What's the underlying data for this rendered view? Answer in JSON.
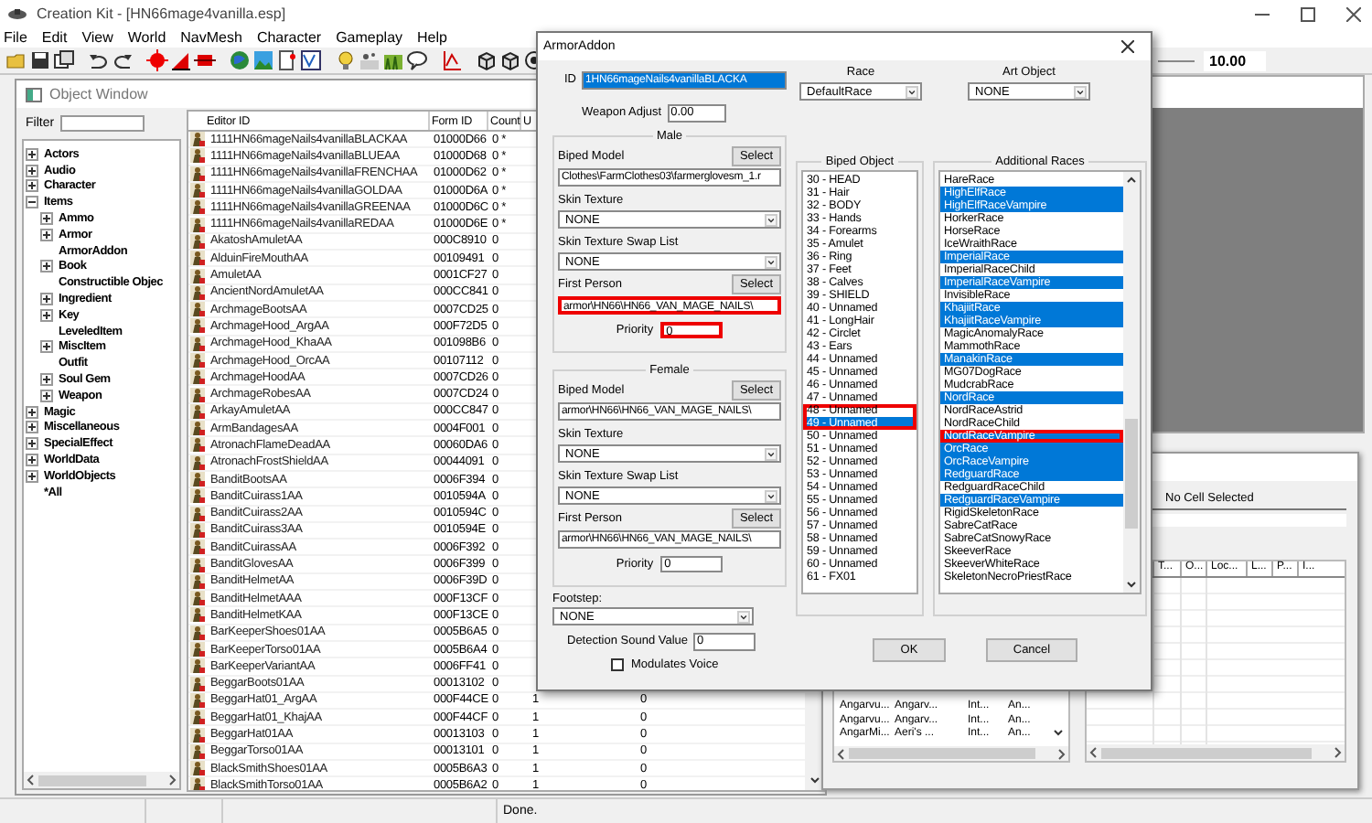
{
  "app_window": {
    "title": "Creation Kit - [HN66mage4vanilla.esp]"
  },
  "menu_bar": [
    "File",
    "Edit",
    "View",
    "World",
    "NavMesh",
    "Character",
    "Gameplay",
    "Help"
  ],
  "toolbar": {
    "zoom_value": "10.00"
  },
  "object_window": {
    "title": "Object Window",
    "filter_label": "Filter",
    "tree": [
      {
        "label": "Actors",
        "kind": "group",
        "expanded": false
      },
      {
        "label": "Audio",
        "kind": "group",
        "expanded": false
      },
      {
        "label": "Character",
        "kind": "group",
        "expanded": false
      },
      {
        "label": "Items",
        "kind": "group",
        "expanded": true,
        "children": [
          {
            "label": "Ammo",
            "kind": "group",
            "expanded": false
          },
          {
            "label": "Armor",
            "kind": "group",
            "expanded": false
          },
          {
            "label": "ArmorAddon",
            "kind": "leaf"
          },
          {
            "label": "Book",
            "kind": "group",
            "expanded": false
          },
          {
            "label": "Constructible Objec",
            "kind": "leaf"
          },
          {
            "label": "Ingredient",
            "kind": "group",
            "expanded": false
          },
          {
            "label": "Key",
            "kind": "group",
            "expanded": false
          },
          {
            "label": "LeveledItem",
            "kind": "leaf"
          },
          {
            "label": "MiscItem",
            "kind": "group",
            "expanded": false
          },
          {
            "label": "Outfit",
            "kind": "leaf"
          },
          {
            "label": "Soul Gem",
            "kind": "group",
            "expanded": false
          },
          {
            "label": "Weapon",
            "kind": "group",
            "expanded": false
          }
        ]
      },
      {
        "label": "Magic",
        "kind": "group",
        "expanded": false
      },
      {
        "label": "Miscellaneous",
        "kind": "group",
        "expanded": false
      },
      {
        "label": "SpecialEffect",
        "kind": "group",
        "expanded": false
      },
      {
        "label": "WorldData",
        "kind": "group",
        "expanded": false
      },
      {
        "label": "WorldObjects",
        "kind": "group",
        "expanded": false
      },
      {
        "label": "*All",
        "kind": "leaf"
      }
    ],
    "table": {
      "columns": [
        "Editor ID",
        "Form ID",
        "Count",
        "U"
      ],
      "rows": [
        {
          "editor_id": "1111HN66mageNails4vanillaBLACKAA",
          "form_id": "01000D66",
          "count": "0 *"
        },
        {
          "editor_id": "1111HN66mageNails4vanillaBLUEAA",
          "form_id": "01000D68",
          "count": "0 *"
        },
        {
          "editor_id": "1111HN66mageNails4vanillaFRENCHAA",
          "form_id": "01000D62",
          "count": "0 *"
        },
        {
          "editor_id": "1111HN66mageNails4vanillaGOLDAA",
          "form_id": "01000D6A",
          "count": "0 *"
        },
        {
          "editor_id": "1111HN66mageNails4vanillaGREENAA",
          "form_id": "01000D6C",
          "count": "0 *"
        },
        {
          "editor_id": "1111HN66mageNails4vanillaREDAA",
          "form_id": "01000D6E",
          "count": "0 *"
        },
        {
          "editor_id": "AkatoshAmuletAA",
          "form_id": "000C8910",
          "count": "0"
        },
        {
          "editor_id": "AlduinFireMouthAA",
          "form_id": "00109491",
          "count": "0"
        },
        {
          "editor_id": "AmuletAA",
          "form_id": "0001CF27",
          "count": "0"
        },
        {
          "editor_id": "AncientNordAmuletAA",
          "form_id": "000CC841",
          "count": "0"
        },
        {
          "editor_id": "ArchmageBootsAA",
          "form_id": "0007CD25",
          "count": "0"
        },
        {
          "editor_id": "ArchmageHood_ArgAA",
          "form_id": "000F72D5",
          "count": "0"
        },
        {
          "editor_id": "ArchmageHood_KhaAA",
          "form_id": "001098B6",
          "count": "0"
        },
        {
          "editor_id": "ArchmageHood_OrcAA",
          "form_id": "00107112",
          "count": "0"
        },
        {
          "editor_id": "ArchmageHoodAA",
          "form_id": "0007CD26",
          "count": "0"
        },
        {
          "editor_id": "ArchmageRobesAA",
          "form_id": "0007CD24",
          "count": "0"
        },
        {
          "editor_id": "ArkayAmuletAA",
          "form_id": "000CC847",
          "count": "0"
        },
        {
          "editor_id": "ArmBandagesAA",
          "form_id": "0004F001",
          "count": "0"
        },
        {
          "editor_id": "AtronachFlameDeadAA",
          "form_id": "00060DA6",
          "count": "0"
        },
        {
          "editor_id": "AtronachFrostShieldAA",
          "form_id": "00044091",
          "count": "0"
        },
        {
          "editor_id": "BanditBootsAA",
          "form_id": "0006F394",
          "count": "0"
        },
        {
          "editor_id": "BanditCuirass1AA",
          "form_id": "0010594A",
          "count": "0"
        },
        {
          "editor_id": "BanditCuirass2AA",
          "form_id": "0010594C",
          "count": "0"
        },
        {
          "editor_id": "BanditCuirass3AA",
          "form_id": "0010594E",
          "count": "0"
        },
        {
          "editor_id": "BanditCuirassAA",
          "form_id": "0006F392",
          "count": "0"
        },
        {
          "editor_id": "BanditGlovesAA",
          "form_id": "0006F399",
          "count": "0"
        },
        {
          "editor_id": "BanditHelmetAA",
          "form_id": "0006F39D",
          "count": "0"
        },
        {
          "editor_id": "BanditHelmetAAA",
          "form_id": "000F13CF",
          "count": "0"
        },
        {
          "editor_id": "BanditHelmetKAA",
          "form_id": "000F13CE",
          "count": "0"
        },
        {
          "editor_id": "BarKeeperShoes01AA",
          "form_id": "0005B6A5",
          "count": "0"
        },
        {
          "editor_id": "BarKeeperTorso01AA",
          "form_id": "0005B6A4",
          "count": "0"
        },
        {
          "editor_id": "BarKeeperVariantAA",
          "form_id": "0006FF41",
          "count": "0"
        },
        {
          "editor_id": "BeggarBoots01AA",
          "form_id": "00013102",
          "count": "0"
        },
        {
          "editor_id": "BeggarHat01_ArgAA",
          "form_id": "000F44CE",
          "count": "0",
          "column_4": "1",
          "column_6": "0"
        },
        {
          "editor_id": "BeggarHat01_KhajAA",
          "form_id": "000F44CF",
          "count": "0",
          "column_4": "1",
          "column_6": "0"
        },
        {
          "editor_id": "BeggarHat01AA",
          "form_id": "00013103",
          "count": "0",
          "column_4": "1",
          "column_6": "0"
        },
        {
          "editor_id": "BeggarTorso01AA",
          "form_id": "00013101",
          "count": "0",
          "column_4": "1",
          "column_6": "0"
        },
        {
          "editor_id": "BlackSmithShoes01AA",
          "form_id": "0005B6A3",
          "count": "0",
          "column_4": "1",
          "column_6": "0"
        },
        {
          "editor_id": "BlackSmithTorso01AA",
          "form_id": "0005B6A2",
          "count": "0",
          "column_4": "1",
          "column_6": "0"
        }
      ]
    }
  },
  "cell_view": {
    "cell_label": "No Cell Selected",
    "cell_rows": [
      [
        "Angarvu...",
        "Angarv...",
        "Int...",
        "An..."
      ],
      [
        "Angarvu...",
        "Angarv...",
        "Int...",
        "An..."
      ],
      [
        "AngarMi...",
        "Aeri's ...",
        "Int...",
        "An..."
      ]
    ],
    "object_columns": [
      "T...",
      "O...",
      "Loc...",
      "L...",
      "P...",
      "I..."
    ]
  },
  "dialog": {
    "title": "ArmorAddon",
    "id": {
      "label": "ID",
      "value": "1HN66mageNails4vanillaBLACKA",
      "text_selected": true
    },
    "weapon_adjust": {
      "label": "Weapon Adjust",
      "value": "0.00"
    },
    "race": {
      "label": "Race",
      "value": "DefaultRace"
    },
    "art_object": {
      "label": "Art Object",
      "value": "NONE"
    },
    "sections": [
      {
        "title": "Male",
        "biped_model": {
          "label": "Biped Model",
          "button": "Select",
          "path": "Clothes\\FarmClothes03\\farmerglovesm_1.r",
          "highlighted": false
        },
        "skin_texture": {
          "label": "Skin Texture",
          "value": "NONE"
        },
        "skin_texture_swap_list": {
          "label": "Skin Texture Swap List",
          "value": "NONE"
        },
        "first_person": {
          "label": "First Person",
          "button": "Select",
          "path": "armor\\HN66\\HN66_VAN_MAGE_NAILS\\",
          "highlighted": true
        },
        "priority": {
          "label": "Priority",
          "value": "0",
          "highlighted": true
        }
      },
      {
        "title": "Female",
        "biped_model": {
          "label": "Biped Model",
          "button": "Select",
          "path": "armor\\HN66\\HN66_VAN_MAGE_NAILS\\",
          "highlighted": false
        },
        "skin_texture": {
          "label": "Skin Texture",
          "value": "NONE"
        },
        "skin_texture_swap_list": {
          "label": "Skin Texture Swap List",
          "value": "NONE"
        },
        "first_person": {
          "label": "First Person",
          "button": "Select",
          "path": "armor\\HN66\\HN66_VAN_MAGE_NAILS\\",
          "highlighted": false
        },
        "priority": {
          "label": "Priority",
          "value": "0",
          "highlighted": false
        }
      }
    ],
    "footstep": {
      "label": "Footstep:",
      "value": "NONE"
    },
    "detection_sound": {
      "label": "Detection Sound Value",
      "value": "0"
    },
    "modulates_voice": {
      "label": "Modulates Voice",
      "checked": false
    },
    "biped_object": {
      "title": "Biped Object",
      "items": [
        {
          "label": "30 - HEAD",
          "selected": false,
          "highlighted": false
        },
        {
          "label": "31 - Hair",
          "selected": false,
          "highlighted": false
        },
        {
          "label": "32 - BODY",
          "selected": false,
          "highlighted": false
        },
        {
          "label": "33 - Hands",
          "selected": false,
          "highlighted": false
        },
        {
          "label": "34 - Forearms",
          "selected": false,
          "highlighted": false
        },
        {
          "label": "35 - Amulet",
          "selected": false,
          "highlighted": false
        },
        {
          "label": "36 - Ring",
          "selected": false,
          "highlighted": false
        },
        {
          "label": "37 - Feet",
          "selected": false,
          "highlighted": false
        },
        {
          "label": "38 - Calves",
          "selected": false,
          "highlighted": false
        },
        {
          "label": "39 - SHIELD",
          "selected": false,
          "highlighted": false
        },
        {
          "label": "40 - Unnamed",
          "selected": false,
          "highlighted": false
        },
        {
          "label": "41 - LongHair",
          "selected": false,
          "highlighted": false
        },
        {
          "label": "42 - Circlet",
          "selected": false,
          "highlighted": false
        },
        {
          "label": "43 - Ears",
          "selected": false,
          "highlighted": false
        },
        {
          "label": "44 - Unnamed",
          "selected": false,
          "highlighted": false
        },
        {
          "label": "45 - Unnamed",
          "selected": false,
          "highlighted": false
        },
        {
          "label": "46 - Unnamed",
          "selected": false,
          "highlighted": false
        },
        {
          "label": "47 - Unnamed",
          "selected": false,
          "highlighted": false
        },
        {
          "label": "48 - Unnamed",
          "selected": false,
          "highlighted": true
        },
        {
          "label": "49 - Unnamed",
          "selected": true,
          "highlighted": true
        },
        {
          "label": "50 - Unnamed",
          "selected": false,
          "highlighted": false
        },
        {
          "label": "51 - Unnamed",
          "selected": false,
          "highlighted": false
        },
        {
          "label": "52 - Unnamed",
          "selected": false,
          "highlighted": false
        },
        {
          "label": "53 - Unnamed",
          "selected": false,
          "highlighted": false
        },
        {
          "label": "54 - Unnamed",
          "selected": false,
          "highlighted": false
        },
        {
          "label": "55 - Unnamed",
          "selected": false,
          "highlighted": false
        },
        {
          "label": "56 - Unnamed",
          "selected": false,
          "highlighted": false
        },
        {
          "label": "57 - Unnamed",
          "selected": false,
          "highlighted": false
        },
        {
          "label": "58 - Unnamed",
          "selected": false,
          "highlighted": false
        },
        {
          "label": "59 - Unnamed",
          "selected": false,
          "highlighted": false
        },
        {
          "label": "60 - Unnamed",
          "selected": false,
          "highlighted": false
        },
        {
          "label": "61 - FX01",
          "selected": false,
          "highlighted": false
        }
      ]
    },
    "additional_races": {
      "title": "Additional Races",
      "items": [
        {
          "label": "HareRace",
          "selected": false,
          "highlighted": false
        },
        {
          "label": "HighElfRace",
          "selected": true,
          "highlighted": false
        },
        {
          "label": "HighElfRaceVampire",
          "selected": true,
          "highlighted": false
        },
        {
          "label": "HorkerRace",
          "selected": false,
          "highlighted": false
        },
        {
          "label": "HorseRace",
          "selected": false,
          "highlighted": false
        },
        {
          "label": "IceWraithRace",
          "selected": false,
          "highlighted": false
        },
        {
          "label": "ImperialRace",
          "selected": true,
          "highlighted": false
        },
        {
          "label": "ImperialRaceChild",
          "selected": false,
          "highlighted": false
        },
        {
          "label": "ImperialRaceVampire",
          "selected": true,
          "highlighted": false
        },
        {
          "label": "InvisibleRace",
          "selected": false,
          "highlighted": false
        },
        {
          "label": "KhajiitRace",
          "selected": true,
          "highlighted": false
        },
        {
          "label": "KhajiitRaceVampire",
          "selected": true,
          "highlighted": false
        },
        {
          "label": "MagicAnomalyRace",
          "selected": false,
          "highlighted": false
        },
        {
          "label": "MammothRace",
          "selected": false,
          "highlighted": false
        },
        {
          "label": "ManakinRace",
          "selected": true,
          "highlighted": false
        },
        {
          "label": "MG07DogRace",
          "selected": false,
          "highlighted": false
        },
        {
          "label": "MudcrabRace",
          "selected": false,
          "highlighted": false
        },
        {
          "label": "NordRace",
          "selected": true,
          "highlighted": false
        },
        {
          "label": "NordRaceAstrid",
          "selected": false,
          "highlighted": false
        },
        {
          "label": "NordRaceChild",
          "selected": false,
          "highlighted": false
        },
        {
          "label": "NordRaceVampire",
          "selected": true,
          "highlighted": true
        },
        {
          "label": "OrcRace",
          "selected": true,
          "highlighted": false
        },
        {
          "label": "OrcRaceVampire",
          "selected": true,
          "highlighted": false
        },
        {
          "label": "RedguardRace",
          "selected": true,
          "highlighted": false
        },
        {
          "label": "RedguardRaceChild",
          "selected": false,
          "highlighted": false
        },
        {
          "label": "RedguardRaceVampire",
          "selected": true,
          "highlighted": false
        },
        {
          "label": "RigidSkeletonRace",
          "selected": false,
          "highlighted": false
        },
        {
          "label": "SabreCatRace",
          "selected": false,
          "highlighted": false
        },
        {
          "label": "SabreCatSnowyRace",
          "selected": false,
          "highlighted": false
        },
        {
          "label": "SkeeverRace",
          "selected": false,
          "highlighted": false
        },
        {
          "label": "SkeeverWhiteRace",
          "selected": false,
          "highlighted": false
        },
        {
          "label": "SkeletonNecroPriestRace",
          "selected": false,
          "highlighted": false
        }
      ]
    },
    "buttons": [
      "OK",
      "Cancel"
    ]
  },
  "status_bar": {
    "message": "Done."
  }
}
